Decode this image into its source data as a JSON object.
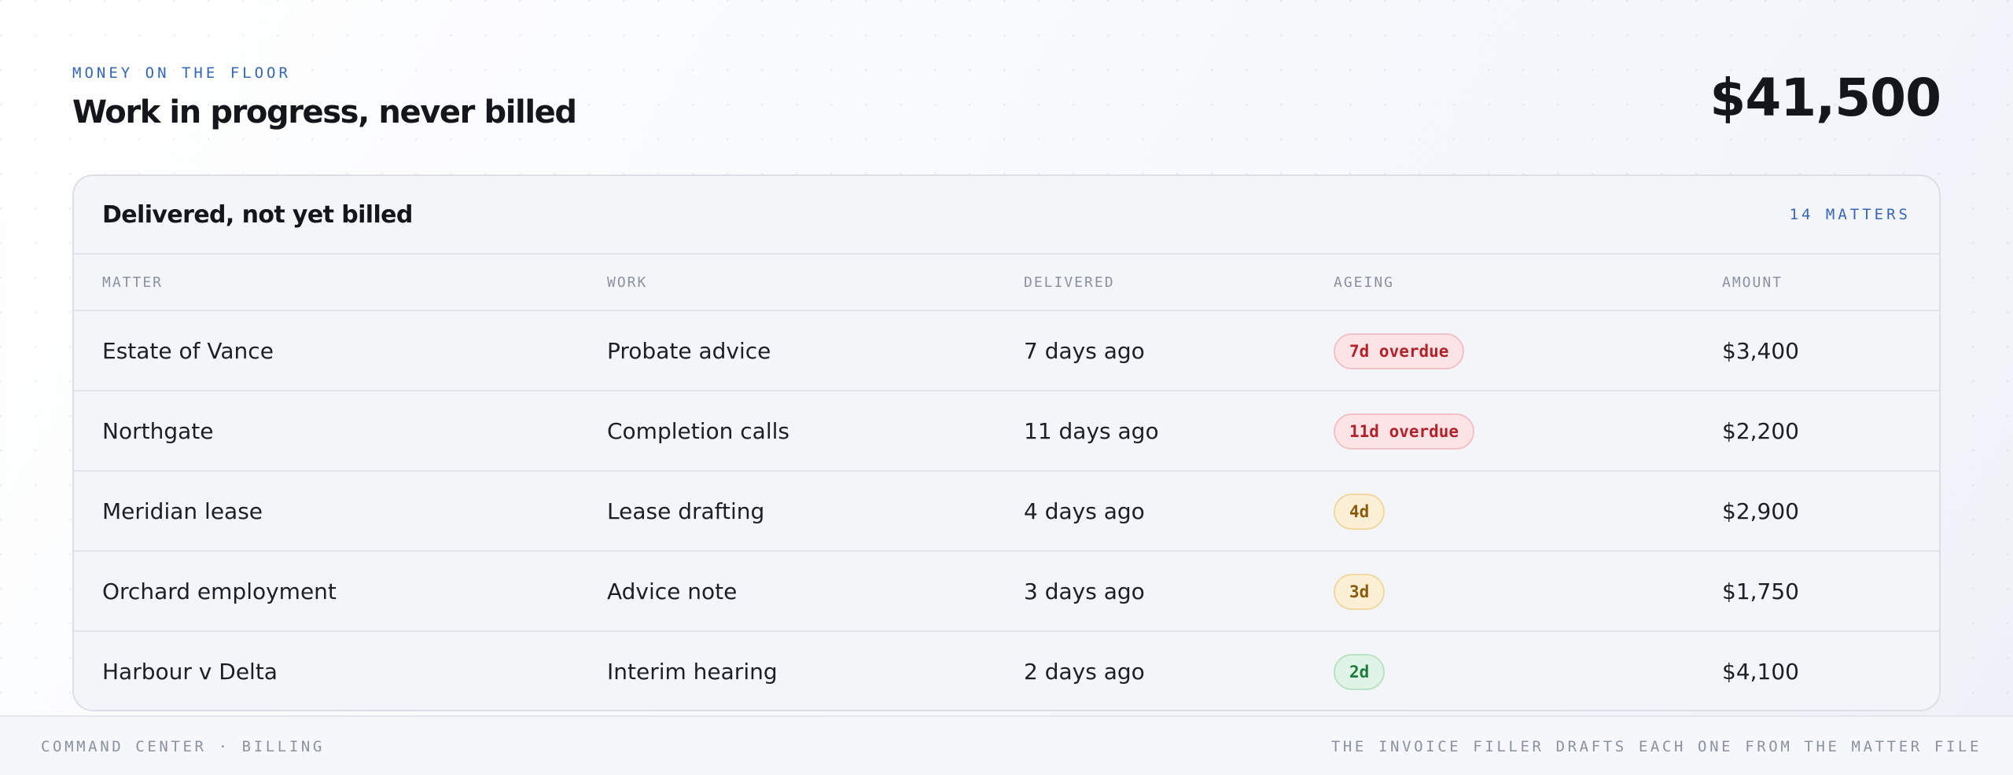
{
  "header": {
    "eyebrow": "MONEY ON THE FLOOR",
    "title": "Work in progress, never billed",
    "total": "$41,500"
  },
  "card": {
    "title": "Delivered, not yet billed",
    "count": "14 MATTERS",
    "columns": [
      "MATTER",
      "WORK",
      "DELIVERED",
      "AGEING",
      "AMOUNT"
    ],
    "rows": [
      {
        "matter": "Estate of Vance",
        "work": "Probate advice",
        "delivered": "7 days ago",
        "ageing": "7d overdue",
        "status": "overdue",
        "amount": "$3,400"
      },
      {
        "matter": "Northgate",
        "work": "Completion calls",
        "delivered": "11 days ago",
        "ageing": "11d overdue",
        "status": "overdue",
        "amount": "$2,200"
      },
      {
        "matter": "Meridian lease",
        "work": "Lease drafting",
        "delivered": "4 days ago",
        "ageing": "4d",
        "status": "warning",
        "amount": "$2,900"
      },
      {
        "matter": "Orchard employment",
        "work": "Advice note",
        "delivered": "3 days ago",
        "ageing": "3d",
        "status": "warning",
        "amount": "$1,750"
      },
      {
        "matter": "Harbour v Delta",
        "work": "Interim hearing",
        "delivered": "2 days ago",
        "ageing": "2d",
        "status": "ok",
        "amount": "$4,100"
      }
    ]
  },
  "footer": {
    "left": "COMMAND CENTER · BILLING",
    "right": "THE INVOICE FILLER DRAFTS EACH ONE FROM THE MATTER FILE"
  },
  "colors": {
    "accent": "#3566b8",
    "overdue": "#b1222b",
    "warning": "#8a5a0a",
    "ok": "#1c7a3c"
  }
}
